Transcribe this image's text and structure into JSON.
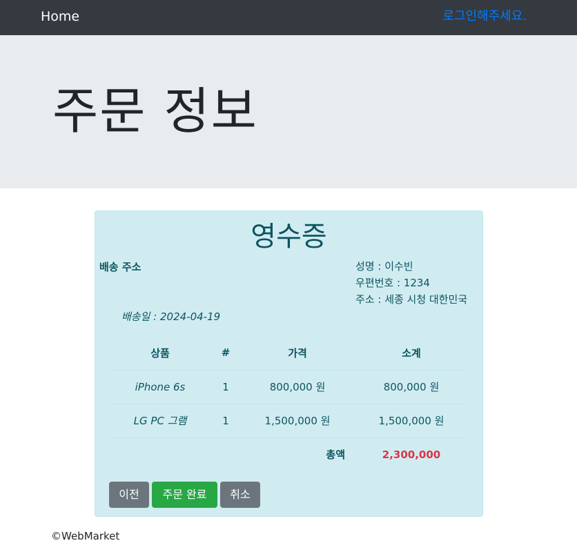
{
  "nav": {
    "home": "Home",
    "login": "로그인해주세요."
  },
  "jumbotron": {
    "title": "주문 정보"
  },
  "receipt": {
    "title": "영수증",
    "shipping_label": "배송 주소",
    "name": "성명 : 이수빈",
    "zip": "우편번호 : 1234",
    "address": "주소 : 세종 시청 대한민국",
    "ship_date": "배송일 : 2024-04-19",
    "headers": [
      "상품",
      "#",
      "가격",
      "소계"
    ],
    "rows": [
      {
        "product": "iPhone 6s",
        "qty": "1",
        "price": "800,000 원",
        "subtotal": "800,000 원"
      },
      {
        "product": "LG PC 그램",
        "qty": "1",
        "price": "1,500,000 원",
        "subtotal": "1,500,000 원"
      }
    ],
    "total_label": "총액",
    "total_value": "2,300,000",
    "buttons": {
      "prev": "이전",
      "complete": "주문 완료",
      "cancel": "취소"
    }
  },
  "footer": {
    "text": "©WebMarket"
  },
  "colors": {
    "navbar": "#343a40",
    "link": "#007bff",
    "receipt_bg": "#d1ecf1",
    "total": "#dc3545",
    "success": "#28a745",
    "secondary": "#6c757d"
  }
}
